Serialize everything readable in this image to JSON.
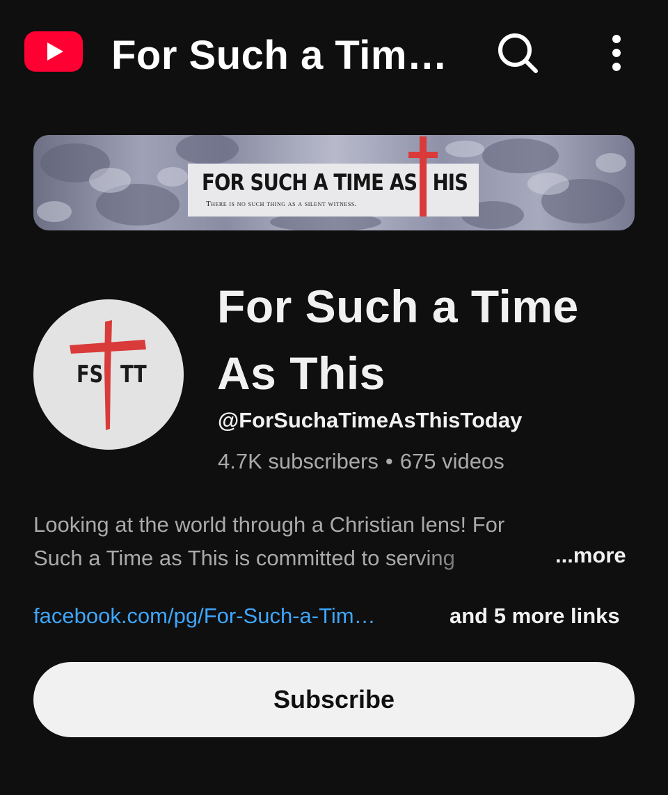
{
  "topbar": {
    "logo_icon": "youtube-logo-icon",
    "title": "For Such a Tim…",
    "search_icon": "search-icon",
    "more_icon": "more-vertical-icon"
  },
  "banner": {
    "title_left": "FOR SUCH A TIME AS",
    "title_right": "HIS",
    "tagline": "There is no such thing as a silent witness."
  },
  "avatar": {
    "left": "FS",
    "right": "TT"
  },
  "channel": {
    "name": "For Such a Time As This",
    "handle": "@ForSuchaTimeAsThisToday",
    "subscribers": "4.7K subscribers",
    "separator": "•",
    "videos": "675 videos"
  },
  "description": {
    "line1": "Looking at the world through a Christian lens!  For",
    "line2": "Such a Time as This is committed to serving",
    "more_label": "...more"
  },
  "links": {
    "primary": "facebook.com/pg/For-Such-a-Tim…",
    "more": "and 5 more links"
  },
  "subscribe_label": "Subscribe",
  "colors": {
    "background": "#0f0f0f",
    "brand_red": "#ff0033",
    "link_blue": "#3ea6ff",
    "cross_red": "#d93a3a"
  }
}
